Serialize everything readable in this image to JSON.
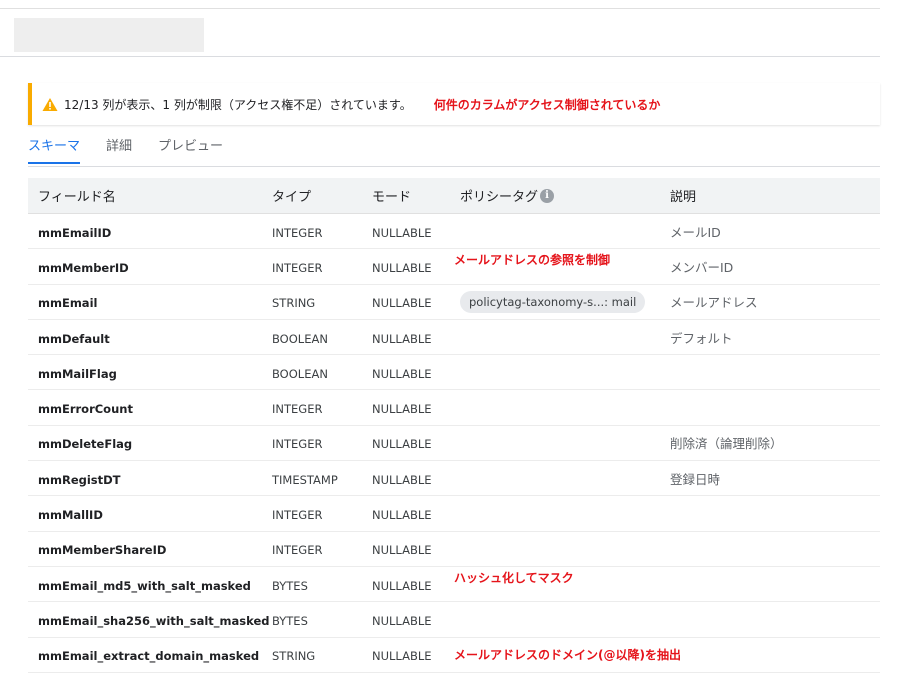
{
  "alert": {
    "icon": "warning-icon",
    "text": "12/13 列が表示、1 列が制限（アクセス権不足）されています。",
    "annotation": "何件のカラムがアクセス制御されているか"
  },
  "tabs": [
    {
      "label": "スキーマ",
      "active": true
    },
    {
      "label": "詳細",
      "active": false
    },
    {
      "label": "プレビュー",
      "active": false
    }
  ],
  "table": {
    "headers": {
      "name": "フィールド名",
      "type": "タイプ",
      "mode": "モード",
      "policy_tag": "ポリシータグ",
      "description": "説明"
    },
    "rows": [
      {
        "name": "mmEmailID",
        "type": "INTEGER",
        "mode": "NULLABLE",
        "policy_tag": "",
        "description": "メールID"
      },
      {
        "name": "mmMemberID",
        "type": "INTEGER",
        "mode": "NULLABLE",
        "policy_tag": "",
        "description": "メンバーID"
      },
      {
        "name": "mmEmail",
        "type": "STRING",
        "mode": "NULLABLE",
        "policy_tag": "policytag-taxonomy-s...: mail",
        "description": "メールアドレス"
      },
      {
        "name": "mmDefault",
        "type": "BOOLEAN",
        "mode": "NULLABLE",
        "policy_tag": "",
        "description": "デフォルト"
      },
      {
        "name": "mmMailFlag",
        "type": "BOOLEAN",
        "mode": "NULLABLE",
        "policy_tag": "",
        "description": ""
      },
      {
        "name": "mmErrorCount",
        "type": "INTEGER",
        "mode": "NULLABLE",
        "policy_tag": "",
        "description": ""
      },
      {
        "name": "mmDeleteFlag",
        "type": "INTEGER",
        "mode": "NULLABLE",
        "policy_tag": "",
        "description": "削除済（論理削除）"
      },
      {
        "name": "mmRegistDT",
        "type": "TIMESTAMP",
        "mode": "NULLABLE",
        "policy_tag": "",
        "description": "登録日時"
      },
      {
        "name": "mmMallID",
        "type": "INTEGER",
        "mode": "NULLABLE",
        "policy_tag": "",
        "description": ""
      },
      {
        "name": "mmMemberShareID",
        "type": "INTEGER",
        "mode": "NULLABLE",
        "policy_tag": "",
        "description": ""
      },
      {
        "name": "mmEmail_md5_with_salt_masked",
        "type": "BYTES",
        "mode": "NULLABLE",
        "policy_tag": "",
        "description": ""
      },
      {
        "name": "mmEmail_sha256_with_salt_masked",
        "type": "BYTES",
        "mode": "NULLABLE",
        "policy_tag": "",
        "description": ""
      },
      {
        "name": "mmEmail_extract_domain_masked",
        "type": "STRING",
        "mode": "NULLABLE",
        "policy_tag": "",
        "description": ""
      }
    ]
  },
  "annotations": {
    "email_ref": "メールアドレスの参照を制御",
    "hash_mask": "ハッシュ化してマスク",
    "domain_extract": "メールアドレスのドメイン(@以降)を抽出"
  },
  "colors": {
    "accent": "#1a73e8",
    "warning": "#f9ab00",
    "annotation": "#e5141b"
  }
}
